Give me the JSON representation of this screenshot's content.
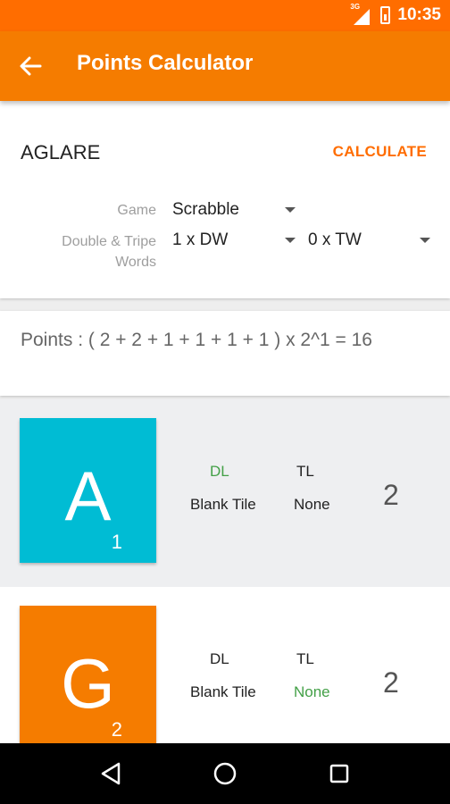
{
  "status": {
    "network": "3G",
    "time": "10:35"
  },
  "appbar": {
    "title": "Points Calculator",
    "back_icon": "arrow-left-icon"
  },
  "input": {
    "word": "AGLARE",
    "calculate_label": "CALCULATE",
    "game_label": "Game",
    "game_value": "Scrabble",
    "words_label_line1": "Double & Tripe",
    "words_label_line2": "Words",
    "dw_value": "1 x DW",
    "tw_value": "0 x TW"
  },
  "result": {
    "formula": "Points : ( 2 + 2 + 1 + 1 + 1 + 1 )  x 2^1 = 16"
  },
  "tiles": [
    {
      "letter": "A",
      "score": "1",
      "color": "#00bcd4",
      "dl": "DL",
      "tl": "TL",
      "dl_active": true,
      "tl_active": false,
      "option1": "Blank Tile",
      "option2": "None",
      "option2_active": false,
      "points": "2"
    },
    {
      "letter": "G",
      "score": "2",
      "color": "#f57c00",
      "dl": "DL",
      "tl": "TL",
      "dl_active": false,
      "tl_active": false,
      "option1": "Blank Tile",
      "option2": "None",
      "option2_active": true,
      "points": "2"
    }
  ],
  "colors": {
    "primary": "#f57c00",
    "status": "#ff6d00",
    "accent_green": "#43a047"
  }
}
